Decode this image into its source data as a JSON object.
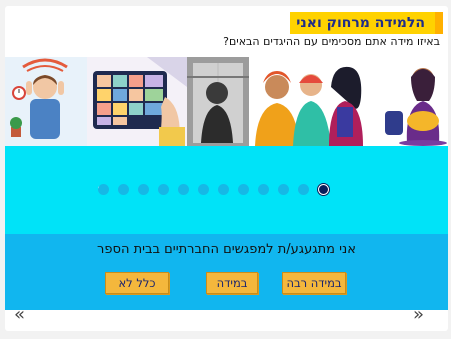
{
  "header": {
    "title": "הלמידה מרחוק ואני",
    "question": "באיזו מידה אתם מסכימים עם ההיגדים הבאים?"
  },
  "carousel": {
    "dot_count": 12,
    "active_index": 11,
    "back_icon": "chevron-left-icon"
  },
  "statement": {
    "text": "אני מתגעגע/ת למפגשים החברתיים בבית הספר"
  },
  "answers": {
    "very_much": "במידה רבה",
    "somewhat": "במידה",
    "not_at_all": "כלל לא"
  },
  "navigation": {
    "prev_glyph": "«",
    "next_glyph": "»"
  },
  "colors": {
    "title_bg": "#ffd200",
    "title_text": "#1f2d8a",
    "cyan_panel": "#00e3f8",
    "answer_panel": "#11b6ef",
    "button_bg": "#f4b73c",
    "dot": "#16b8e6",
    "dot_active": "#0a1f5c"
  }
}
